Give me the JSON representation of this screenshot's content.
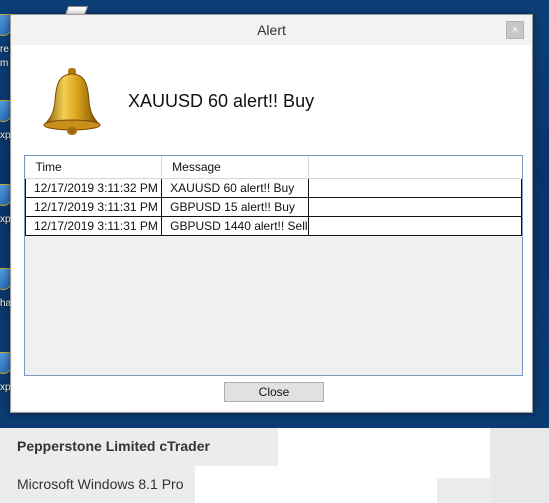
{
  "desktop": {
    "labels": [
      "re",
      "m",
      "xp",
      "xp",
      "ha",
      "xp"
    ]
  },
  "window": {
    "title": "Alert",
    "close_glyph": "×",
    "headline": "XAUUSD 60 alert!! Buy",
    "columns": [
      "Time",
      "Message"
    ],
    "rows": [
      {
        "time": "12/17/2019 3:11:32 PM",
        "message": "XAUUSD 60 alert!! Buy"
      },
      {
        "time": "12/17/2019 3:11:31 PM",
        "message": "GBPUSD 15 alert!! Buy"
      },
      {
        "time": "12/17/2019 3:11:31 PM",
        "message": "GBPUSD 1440 alert!! Sell"
      }
    ],
    "close_button": "Close"
  },
  "info": {
    "product": "Pepperstone Limited cTrader",
    "os": "Microsoft Windows 8.1 Pro"
  },
  "colors": {
    "desktop": "#0b3a6e",
    "grid_border": "#7a9cc0",
    "bell_gold": "#d9a21b"
  },
  "icons": [
    "bell-icon",
    "close-icon",
    "shield-icon"
  ]
}
